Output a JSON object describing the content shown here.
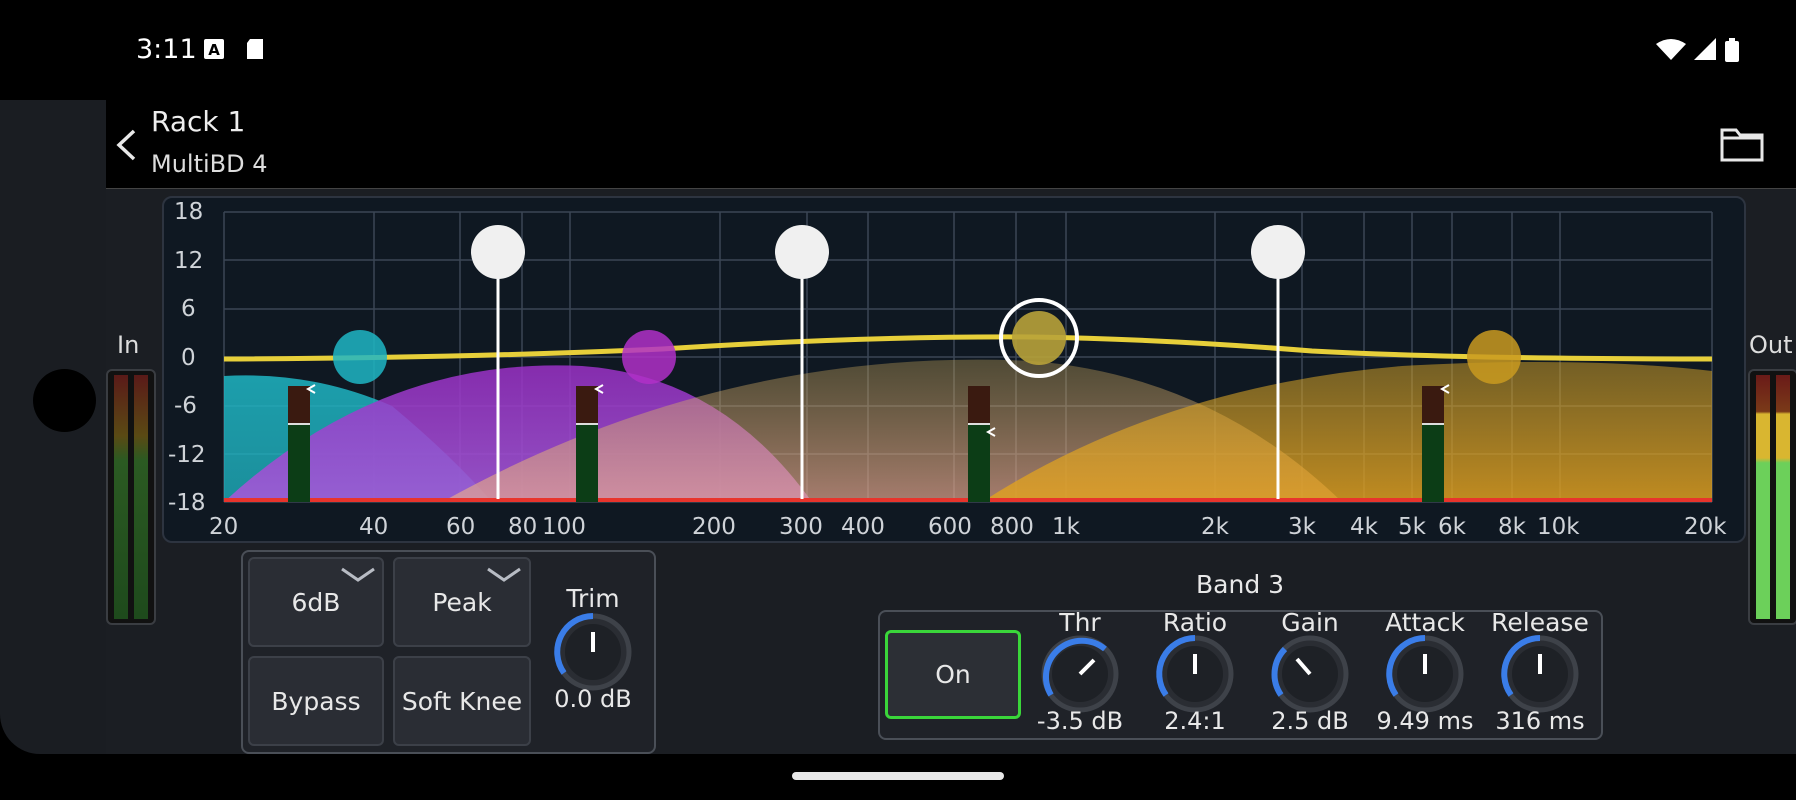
{
  "status_bar": {
    "time": "3:11",
    "icons": [
      "a-icon",
      "sd-card-icon",
      "wifi-icon",
      "signal-icon",
      "battery-icon"
    ]
  },
  "header": {
    "title": "Rack 1",
    "subtitle": "MultiBD 4",
    "back_icon": "chevron-left-icon",
    "folder_icon": "folder-icon"
  },
  "meters": {
    "in_label": "In",
    "out_label": "Out"
  },
  "graph": {
    "y_labels": [
      "18",
      "12",
      "6",
      "0",
      "-6",
      "-12",
      "-18"
    ],
    "x_labels": [
      "20",
      "40",
      "60",
      "80",
      "100",
      "200",
      "300",
      "400",
      "600",
      "800",
      "1k",
      "2k",
      "3k",
      "4k",
      "5k",
      "6k",
      "8k",
      "10k",
      "20k"
    ],
    "colors": {
      "band1": "#1fb6c4",
      "band2": "#a63ad6",
      "band3": "#c9b63a",
      "band4": "#d7a528",
      "curve": "#e7cf3a",
      "floor": "#e8342c"
    }
  },
  "controls_left": {
    "slope_label": "6dB",
    "type_label": "Peak",
    "bypass_label": "Bypass",
    "knee_label": "Soft Knee",
    "trim_label": "Trim",
    "trim_value": "0.0 dB"
  },
  "band": {
    "title": "Band 3",
    "on_label": "On",
    "knobs": [
      {
        "label": "Thr",
        "value": "-3.5 dB"
      },
      {
        "label": "Ratio",
        "value": "2.4:1"
      },
      {
        "label": "Gain",
        "value": "2.5 dB"
      },
      {
        "label": "Attack",
        "value": "9.49 ms"
      },
      {
        "label": "Release",
        "value": "316 ms"
      }
    ]
  }
}
